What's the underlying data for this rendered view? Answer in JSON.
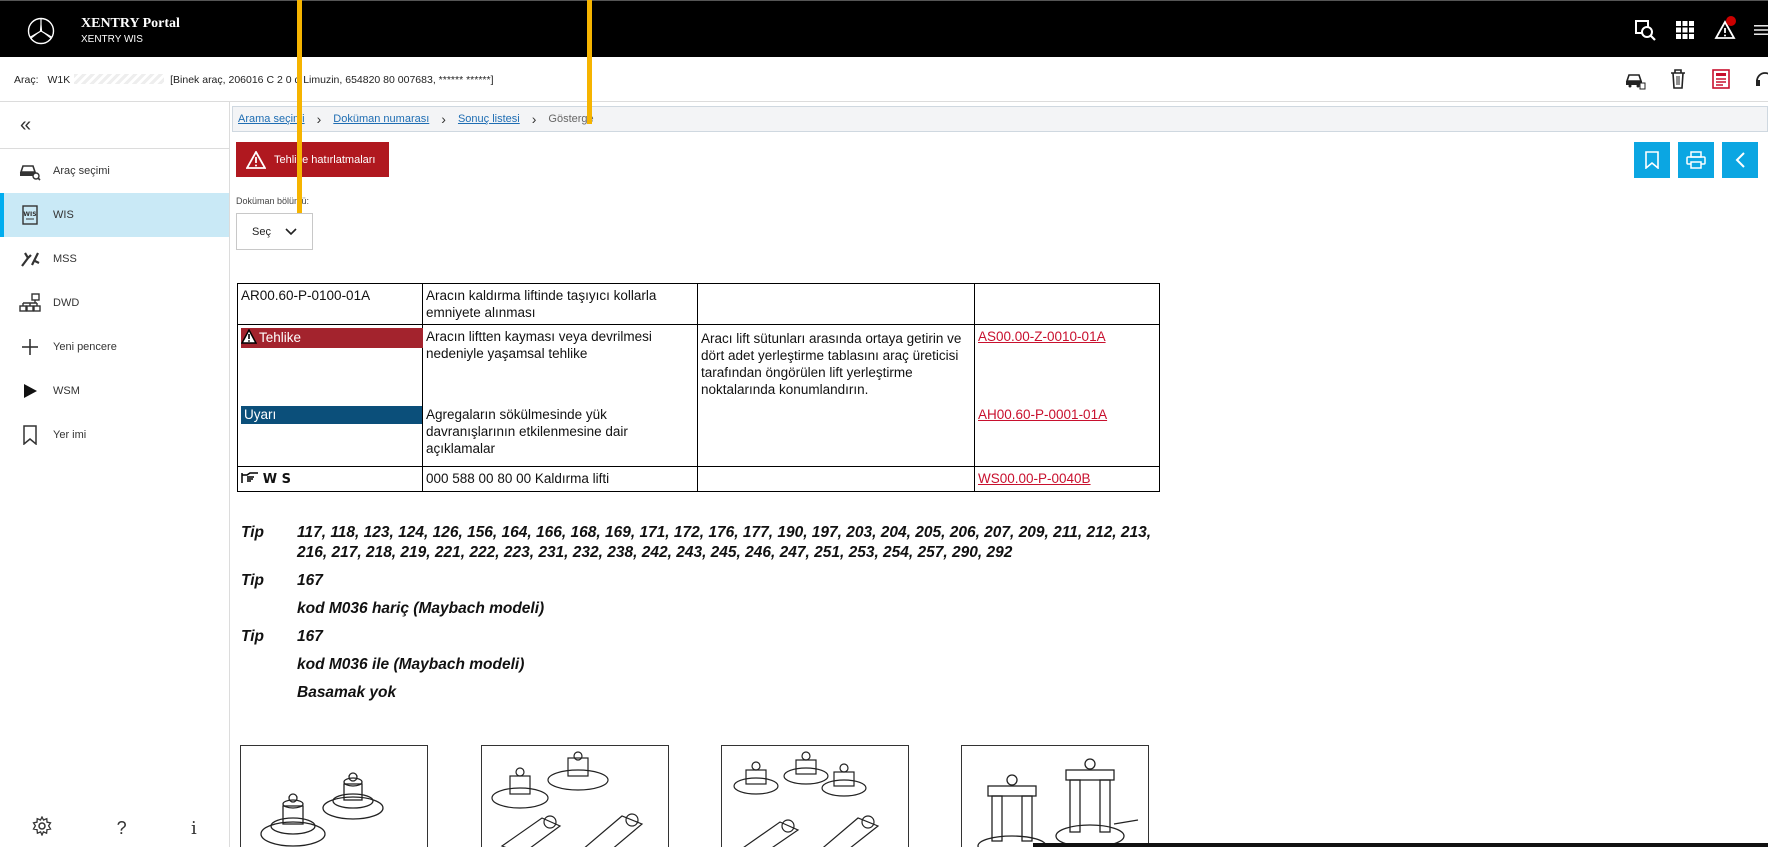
{
  "topbar": {
    "brand_title": "XENTRY Portal",
    "brand_subtitle": "XENTRY WIS",
    "icons": [
      "search-car-icon",
      "grid-icon",
      "warning-icon",
      "menu-icon"
    ]
  },
  "vehicle": {
    "label": "Araç:",
    "vin_prefix": "W1K",
    "details": "[Binek araç, 206016 C 2 0 d Limuzin, 654820 80 007683, ****** ******]",
    "icons": [
      "vehicle-icon",
      "trash-icon",
      "report-icon",
      "headset-icon"
    ]
  },
  "sidebar": {
    "items": [
      {
        "label": "Araç seçimi",
        "icon": "car-search-icon"
      },
      {
        "label": "WIS",
        "icon": "wis-icon"
      },
      {
        "label": "MSS",
        "icon": "mss-icon"
      },
      {
        "label": "DWD",
        "icon": "dwd-icon"
      },
      {
        "label": "Yeni pencere",
        "icon": "plus-icon"
      },
      {
        "label": "WSM",
        "icon": "play-icon"
      },
      {
        "label": "Yer imi",
        "icon": "bookmark-icon"
      }
    ],
    "bottom": {
      "help": "?",
      "info": "i"
    }
  },
  "breadcrumb": [
    {
      "label": "Arama seçimi"
    },
    {
      "label": "Doküman numarası"
    },
    {
      "label": "Sonuç listesi"
    },
    {
      "label": "Gösterge"
    }
  ],
  "danger_button": "Tehlike hatırlatmaları",
  "document_section": {
    "label": "Doküman bölümü:",
    "select_value": "Seç"
  },
  "table": {
    "row1": {
      "code": "AR00.60-P-0100-01A",
      "desc": "Aracın kaldırma liftinde taşıyıcı kollarla emniyete alınması"
    },
    "row2": {
      "danger_label": "Tehlike",
      "danger_desc": "Aracın liftten kayması veya devrilmesi nedeniyle yaşamsal tehlike",
      "danger_measure": "Aracı lift sütunları arasında ortaya getirin ve dört adet yerleştirme tablasını araç üreticisi tarafından öngörülen lift yerleştirme noktalarında konumlandırın.",
      "danger_link": "AS00.00-Z-0010-01A",
      "warning_label": "Uyarı",
      "warning_desc": "Agregaların sökülmesinde yük davranışlarının etkilenmesine dair açıklamalar",
      "warning_link": "AH00.60-P-0001-01A"
    },
    "row3": {
      "label": "W S",
      "desc": "000 588 00 80 00 Kaldırma lifti",
      "link": "WS00.00-P-0040B"
    }
  },
  "tips": [
    {
      "key": "Tip",
      "value": "117, 118, 123, 124, 126, 156, 164, 166, 168, 169, 171, 172, 176, 177, 190, 197, 203, 204, 205, 206, 207, 209, 211, 212, 213, 216, 217, 218, 219, 221, 222, 223, 231, 232, 238, 242, 243, 245, 246, 247, 251, 253, 254, 257, 290, 292"
    },
    {
      "key": "Tip",
      "value": "167"
    },
    {
      "key": "",
      "value": "kod M036 hariç (Maybach modeli)"
    },
    {
      "key": "Tip",
      "value": "167"
    },
    {
      "key": "",
      "value": "kod M036 ile (Maybach modeli)"
    },
    {
      "key": "",
      "value": "Basamak yok"
    }
  ],
  "colors": {
    "accent": "#0ba6e2",
    "danger": "#b0181f",
    "warning_label": "#0b4f7a",
    "link_red": "#c8102e",
    "overlay_arrow": "#f6b400"
  }
}
